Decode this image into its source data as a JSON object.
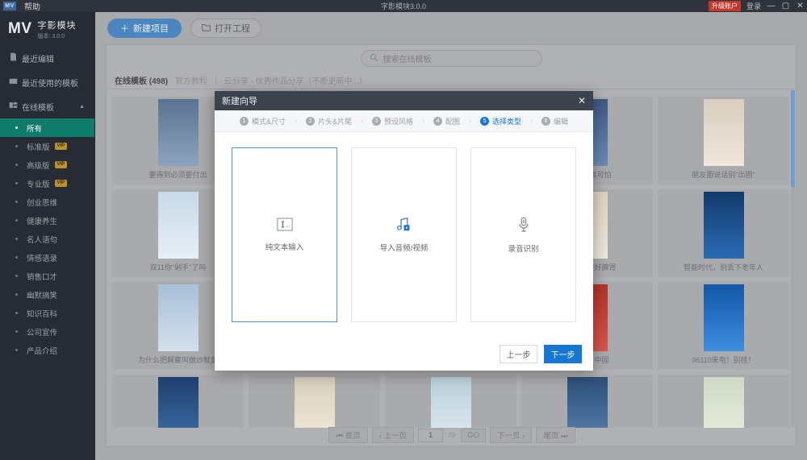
{
  "titlebar": {
    "logo": "MV",
    "help": "帮助",
    "title": "字影模块3.0.0",
    "upgrade": "升级账户",
    "login": "登录",
    "minimize": "—",
    "maximize": "▢",
    "close": "✕"
  },
  "sidebar": {
    "brand_mv": "MV",
    "brand_name": "字影模块",
    "brand_version": "版本: 3.0.0",
    "nav": [
      {
        "label": "最近编辑",
        "icon": "file-icon"
      },
      {
        "label": "最近使用的模板",
        "icon": "card-icon"
      },
      {
        "label": "在线模板",
        "icon": "grid-icon",
        "caret": "▲"
      }
    ],
    "sub_items": [
      {
        "label": "所有",
        "vip": "",
        "active": true
      },
      {
        "label": "标准版",
        "vip": "VIP",
        "active": false
      },
      {
        "label": "高级版",
        "vip": "VIP",
        "active": false
      },
      {
        "label": "专业版",
        "vip": "VIP",
        "active": false
      },
      {
        "label": "创业思维",
        "vip": "",
        "active": false
      },
      {
        "label": "健康养生",
        "vip": "",
        "active": false
      },
      {
        "label": "名人语句",
        "vip": "",
        "active": false
      },
      {
        "label": "情感语录",
        "vip": "",
        "active": false
      },
      {
        "label": "销售口才",
        "vip": "",
        "active": false
      },
      {
        "label": "幽默搞笑",
        "vip": "",
        "active": false
      },
      {
        "label": "知识百科",
        "vip": "",
        "active": false
      },
      {
        "label": "公司宣传",
        "vip": "",
        "active": false
      },
      {
        "label": "产品介绍",
        "vip": "",
        "active": false
      }
    ]
  },
  "toolbar": {
    "new_project": "新建项目",
    "new_project_icon": "plus-icon",
    "open_project": "打开工程",
    "open_project_icon": "folder-icon"
  },
  "search": {
    "placeholder": "搜索在线模板",
    "icon": "search-icon"
  },
  "tabs": [
    {
      "label": "在线模板 (498)",
      "active": true
    },
    {
      "label": "官方教程",
      "active": false
    },
    {
      "label": "|",
      "separator": true
    },
    {
      "label": "云分享 - 优秀作品分享（不断更新中...）",
      "active": false
    }
  ],
  "templates": [
    {
      "caption": "要得到必须要付出"
    },
    {
      "caption": ""
    },
    {
      "caption": ""
    },
    {
      "caption": "没\"文化\"真可怕"
    },
    {
      "caption": "朋友圈说话别\"出圈\""
    },
    {
      "caption": "双11你\"剁手\"了吗"
    },
    {
      "caption": ""
    },
    {
      "caption": ""
    },
    {
      "caption": "教你一招养好脾胃"
    },
    {
      "caption": "智能时代，别丢下老年人"
    },
    {
      "caption": "为什么把解雇叫做炒鱿鱼"
    },
    {
      "caption": ""
    },
    {
      "caption": ""
    },
    {
      "caption": "奔腾吧，中国"
    },
    {
      "caption": "96110来电！别挂！"
    },
    {
      "caption": ""
    },
    {
      "caption": ""
    },
    {
      "caption": ""
    },
    {
      "caption": ""
    },
    {
      "caption": ""
    }
  ],
  "pager": {
    "first": "首页",
    "prev": "上一页",
    "current": "1",
    "total": "/9",
    "go": "GO",
    "next": "下一页",
    "last": "尾页"
  },
  "modal": {
    "title": "新建向导",
    "close_icon": "close-icon",
    "steps": [
      {
        "num": "1",
        "label": "模式&尺寸",
        "active": false
      },
      {
        "num": "2",
        "label": "片头&片尾",
        "active": false
      },
      {
        "num": "3",
        "label": "预设风格",
        "active": false
      },
      {
        "num": "4",
        "label": "配图",
        "active": false
      },
      {
        "num": "5",
        "label": "选择类型",
        "active": true
      },
      {
        "num": "6",
        "label": "编辑",
        "active": false
      }
    ],
    "options": [
      {
        "label": "纯文本输入",
        "icon": "text-input-icon",
        "selected": true
      },
      {
        "label": "导入音频/视频",
        "icon": "music-video-icon",
        "selected": false
      },
      {
        "label": "录音识别",
        "icon": "microphone-icon",
        "selected": false
      }
    ],
    "prev_button": "上一步",
    "next_button": "下一步"
  },
  "colors": {
    "accent_blue": "#1677d2",
    "sidebar_active_green": "#0f7c6b",
    "upgrade_red": "#c0392b",
    "vip_gold": "#b9912f"
  }
}
